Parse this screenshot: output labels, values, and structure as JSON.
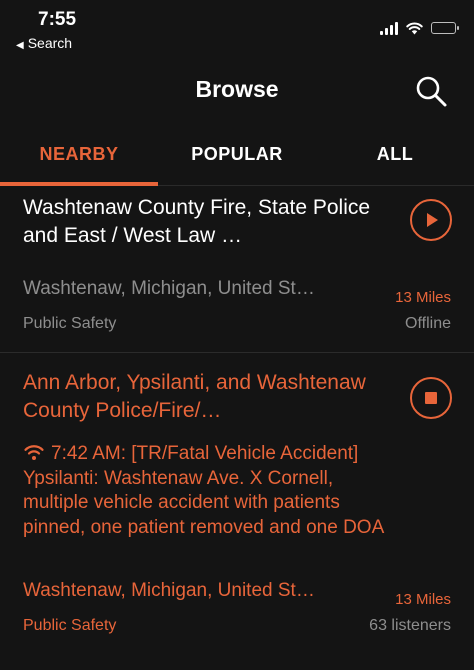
{
  "status_bar": {
    "time": "7:55",
    "back_label": "Search"
  },
  "header": {
    "title": "Browse"
  },
  "tabs": [
    {
      "label": "NEARBY",
      "active": true
    },
    {
      "label": "POPULAR",
      "active": false
    },
    {
      "label": "ALL",
      "active": false
    }
  ],
  "feeds": [
    {
      "title": "Washtenaw County Fire, State Police and East / West Law …",
      "location": "Washtenaw, Michigan, United St…",
      "distance": "13 Miles",
      "category": "Public Safety",
      "status": "Offline",
      "playing": false
    },
    {
      "title": "Ann Arbor, Ypsilanti, and Washtenaw County Police/Fire/…",
      "update": "7:42 AM: [TR/Fatal Vehicle Accident] Ypsilanti: Washtenaw Ave. X Cornell, multiple vehicle accident with patients pinned, one patient removed and one DOA",
      "location": "Washtenaw, Michigan, United St…",
      "distance": "13 Miles",
      "category": "Public Safety",
      "status": "63 listeners",
      "playing": true
    }
  ],
  "colors": {
    "accent": "#e8653a",
    "background": "#141414",
    "muted": "#8e8e8e"
  },
  "icons": {
    "back": "back-triangle-icon",
    "search": "magnifier-icon",
    "play": "play-icon",
    "stop": "stop-icon",
    "live": "broadcast-wifi-icon"
  }
}
